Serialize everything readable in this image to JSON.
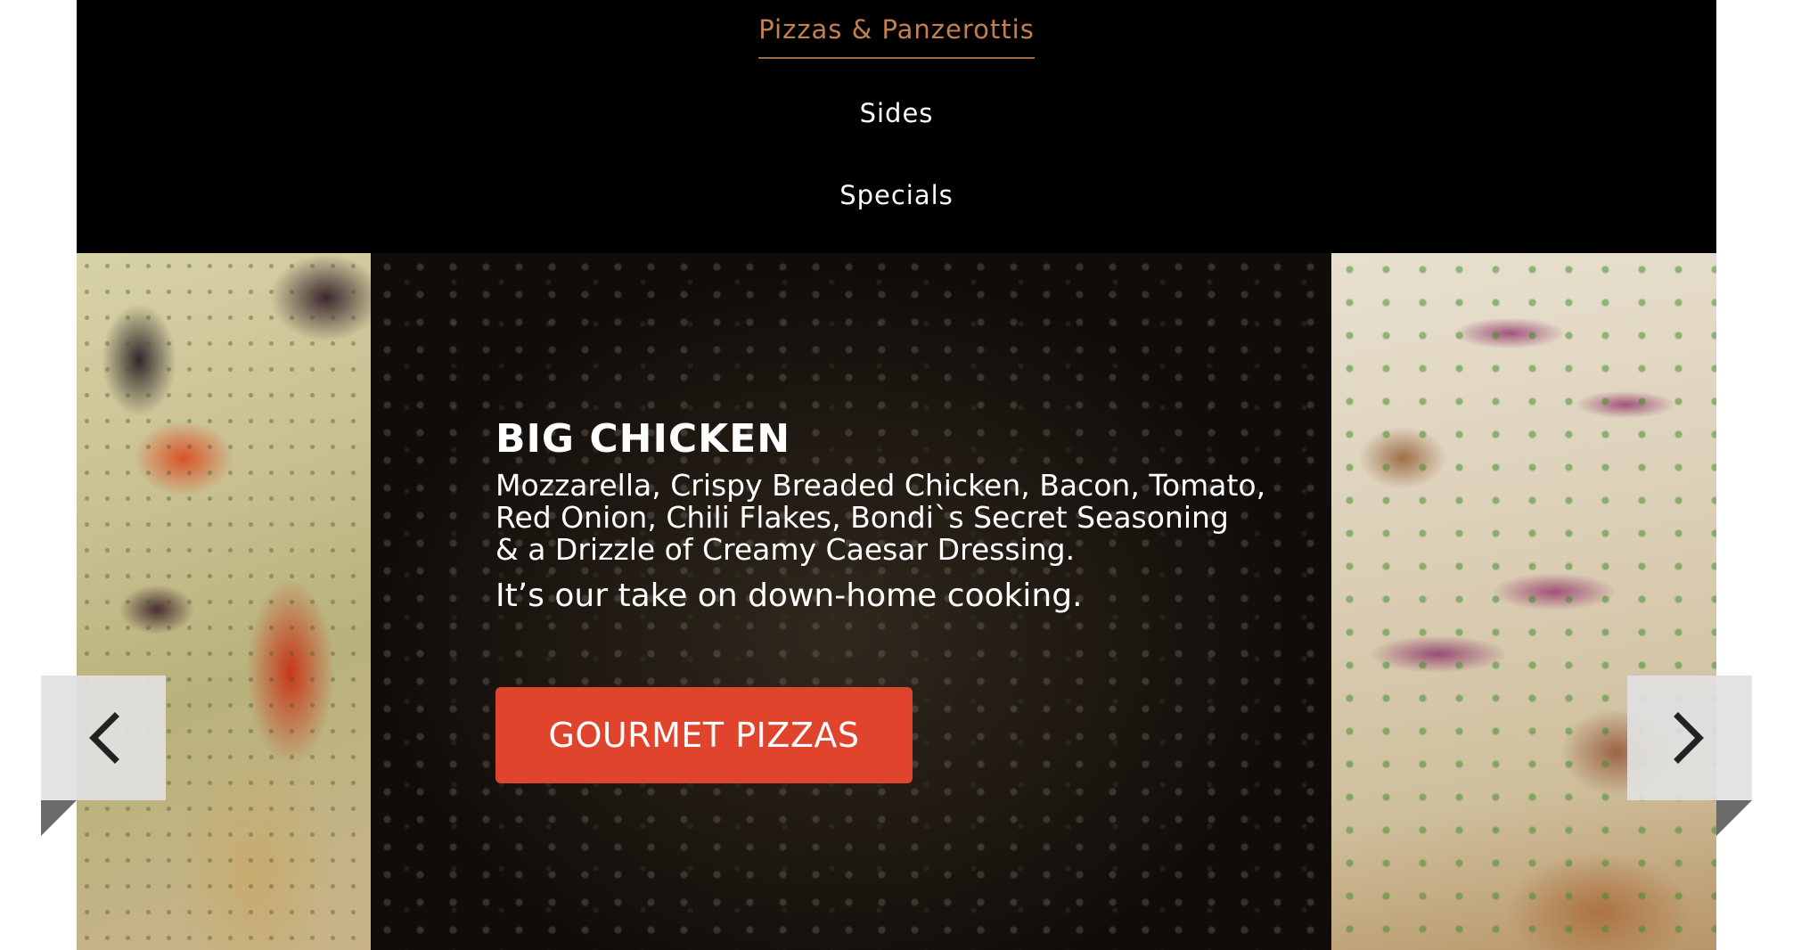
{
  "nav": {
    "items": [
      {
        "label": "Pizzas & Panzerottis",
        "active": true
      },
      {
        "label": "Sides",
        "active": false
      },
      {
        "label": "Specials",
        "active": false
      }
    ],
    "active_color": "#c47f4f"
  },
  "slide": {
    "title": "BIG CHICKEN",
    "description": "Mozzarella, Crispy Breaded Chicken, Bacon, Tomato,\nRed Onion, Chili Flakes, Bondi`s Secret Seasoning\n& a Drizzle of Creamy Caesar Dressing.",
    "tagline": "It’s our take on down-home cooking.",
    "cta_label": "GOURMET PIZZAS",
    "cta_color": "#e1442c"
  },
  "arrows": {
    "prev_icon": "chevron-left-icon",
    "next_icon": "chevron-right-icon"
  }
}
